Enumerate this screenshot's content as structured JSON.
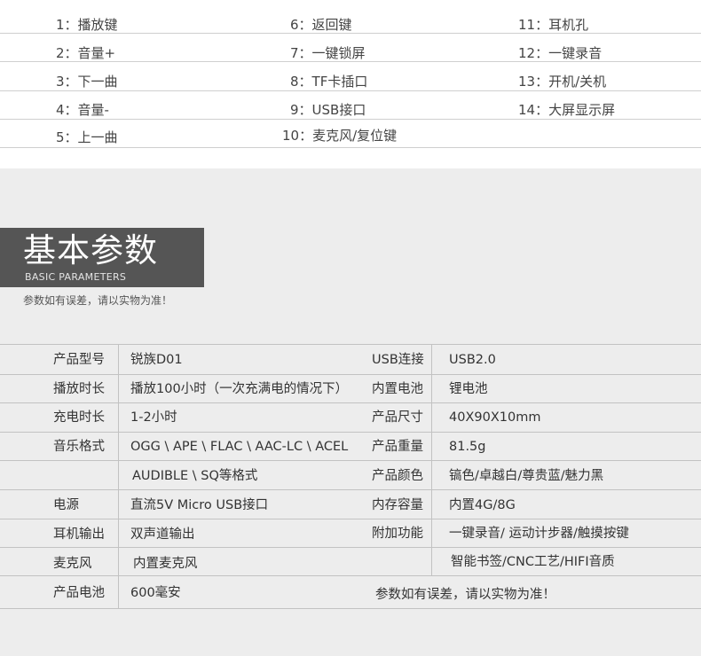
{
  "keys": [
    "1：播放键",
    "6：返回键",
    "11：耳机孔",
    "2：音量+",
    "7：一键锁屏",
    "12：一键录音",
    "3：下一曲",
    "8：TF卡插口",
    "13：开机/关机",
    "4：音量-",
    "9：USB接口",
    "14：大屏显示屏",
    "5：上一曲",
    "10：麦克风/复位键"
  ],
  "section": {
    "title": "基本参数",
    "subtitle": "BASIC PARAMETERS",
    "note": "参数如有误差，请以实物为准！"
  },
  "params": [
    [
      "产品型号",
      "锐族D01",
      "USB连接",
      "USB2.0"
    ],
    [
      "播放时长",
      "播放100小时（一次充满电的情况下）",
      "内置电池",
      "锂电池"
    ],
    [
      "充电时长",
      "1-2小时",
      "产品尺寸",
      "40X90X10mm"
    ],
    [
      "音乐格式",
      "OGG \\ APE \\ FLAC \\ AAC-LC \\ ACEL",
      "产品重量",
      "81.5g"
    ],
    [
      "",
      "AUDIBLE \\ SQ等格式",
      "产品颜色",
      "镐色/卓越白/尊贵蓝/魅力黑"
    ],
    [
      "电源",
      "直流5V Micro USB接口",
      "内存容量",
      "内置4G/8G"
    ],
    [
      "耳机输出",
      "双声道输出",
      "附加功能",
      "一键录音/ 运动计步器/触摸按键"
    ],
    [
      "麦克风",
      "内置麦克风",
      "",
      "智能书签/CNC工艺/HIFI音质"
    ],
    [
      "产品电池",
      "600毫安",
      "",
      ""
    ]
  ],
  "footer_note": "参数如有误差，请以实物为准！"
}
